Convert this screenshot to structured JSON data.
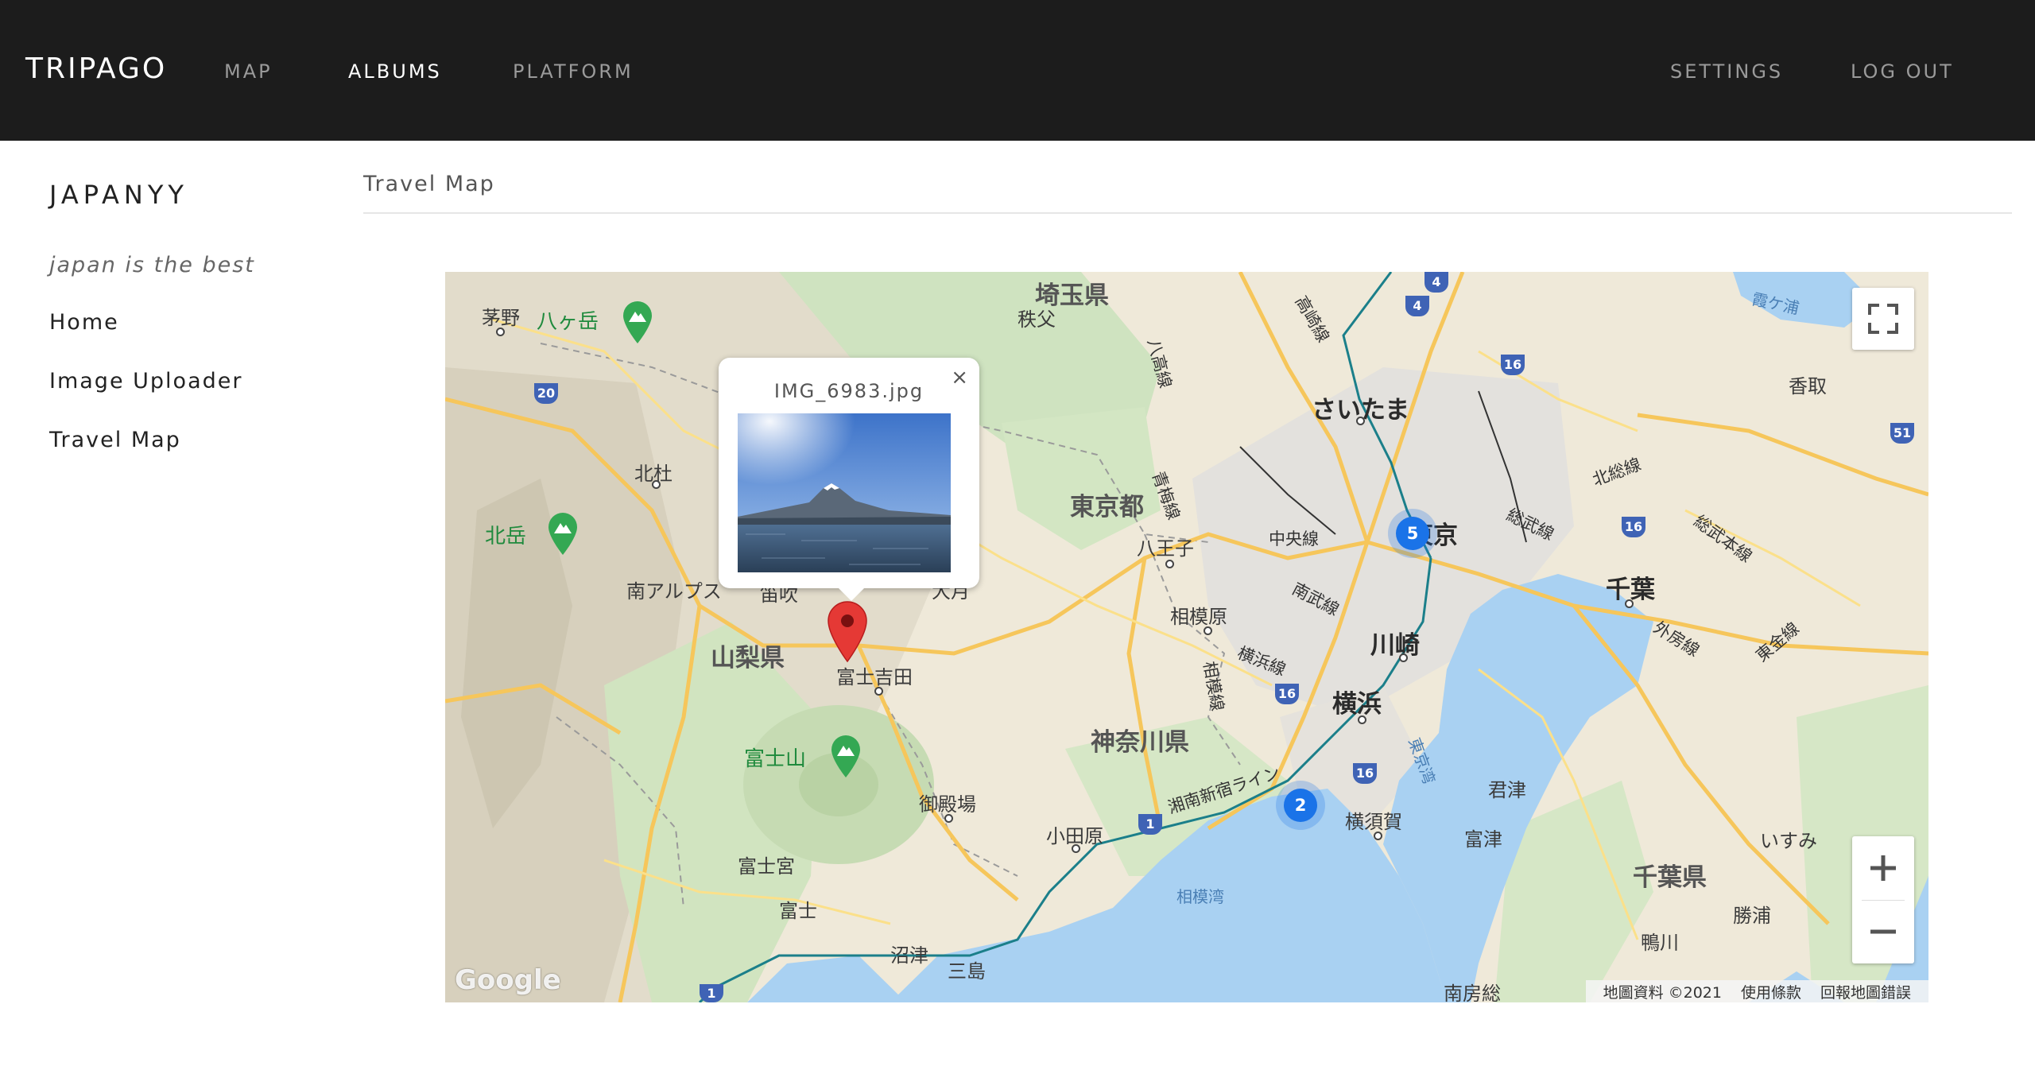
{
  "nav": {
    "brand": "TRIPAGO",
    "left_links": [
      "MAP",
      "ALBUMS",
      "PLATFORM"
    ],
    "active_link": "ALBUMS",
    "right_links": [
      "SETTINGS",
      "LOG OUT"
    ]
  },
  "sidebar": {
    "album_title": "JAPANYY",
    "tagline": "japan is the best",
    "items": [
      "Home",
      "Image Uploader",
      "Travel Map"
    ]
  },
  "content": {
    "title": "Travel Map"
  },
  "map": {
    "popup": {
      "filename": "IMG_6983.jpg",
      "close": "×"
    },
    "clusters": [
      {
        "count": "5"
      },
      {
        "count": "2"
      }
    ],
    "labels": {
      "saitama_pref": "埼玉県",
      "chichibu": "秩父",
      "yatsugatake": "八ヶ岳",
      "chino": "茅野",
      "hokuto": "北杜",
      "kitadake": "北岳",
      "minami_alps": "南アルプス",
      "fuefuki": "笛吹",
      "otsuki": "大月",
      "yamanashi_pref": "山梨県",
      "fujiyoshida": "富士吉田",
      "fujisan": "富士山",
      "gotemba": "御殿場",
      "fujinomiya": "富士宮",
      "fuji": "富士",
      "numazu": "沼津",
      "mishima": "三島",
      "odawara": "小田原",
      "tokyo_pref": "東京都",
      "hachioji": "八王子",
      "sagamihara": "相模原",
      "kanagawa_pref": "神奈川県",
      "saitama_city": "さいたま",
      "tokyo": "東京",
      "kawasaki": "川崎",
      "yokohama": "横浜",
      "yokosuka": "横須賀",
      "chiba": "千葉",
      "chiba_pref": "千葉県",
      "kisarazu": "君津",
      "futtsu": "富津",
      "isumi": "いすみ",
      "katsuura": "勝浦",
      "kamogawa": "鴨川",
      "minamiboso": "南房総",
      "katori": "香取",
      "kasumigaura": "霞ケ浦",
      "sagami_bay": "相模湾",
      "tokyo_bay": "東京湾",
      "chuo_line": "中央線",
      "nambu_line": "南武線",
      "yokohama_line": "横浜線",
      "sagami_line": "相模線",
      "shonan_shinjuku": "湘南新宿ライン",
      "sobu_line": "総武線",
      "sobu_main": "総武本線",
      "hokuso_line": "北総線",
      "sotobo_line": "外房線",
      "togane_line": "東金線",
      "ome_line": "青梅線",
      "hachiko_line": "八高線",
      "takasaki_line": "高崎線"
    },
    "route_shields": [
      "20",
      "16",
      "4",
      "4",
      "16",
      "51",
      "16",
      "16",
      "1",
      "1"
    ],
    "google_logo": "Google",
    "footer": [
      "地圖資料 ©2021",
      "使用條款",
      "回報地圖錯誤"
    ]
  }
}
